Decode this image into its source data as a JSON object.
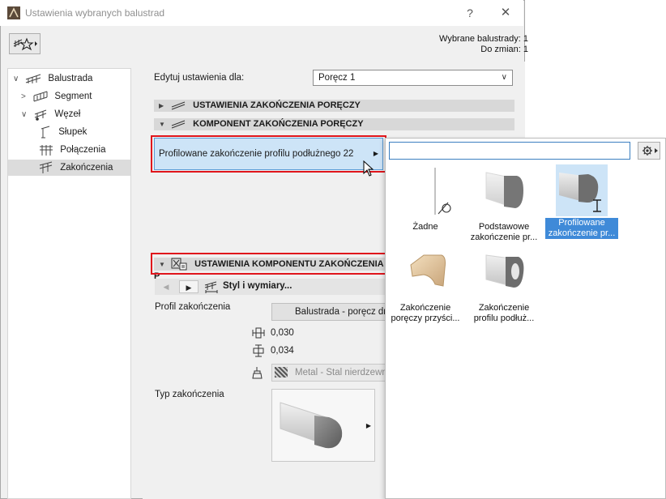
{
  "window": {
    "title": "Ustawienia wybranych balustrad",
    "help": "?",
    "close": "✕"
  },
  "info": {
    "selected": "Wybrane balustrady: 1",
    "to_change": "Do zmian: 1"
  },
  "tree": {
    "items": [
      {
        "label": "Balustrada",
        "arrow": "∨"
      },
      {
        "label": "Segment",
        "arrow": ">"
      },
      {
        "label": "Węzeł",
        "arrow": "∨"
      },
      {
        "label": "Słupek",
        "arrow": ""
      },
      {
        "label": "Połączenia",
        "arrow": ""
      },
      {
        "label": "Zakończenia",
        "arrow": ""
      }
    ],
    "selected_index": 5
  },
  "edit": {
    "label": "Edytuj ustawienia dla:",
    "value": "Poręcz 1"
  },
  "sections": {
    "end_settings": "USTAWIENIA ZAKOŃCZENIA PORĘCZY",
    "end_component": "KOMPONENT ZAKOŃCZENIA PORĘCZY",
    "component_settings": "USTAWIENIA KOMPONENTU ZAKOŃCZENIA P"
  },
  "component_button": "Profilowane zakończenie profilu podłużnego 22",
  "nav": {
    "style_label": "Styl i wymiary..."
  },
  "profile": {
    "label": "Profil zakończenia",
    "value": "Balustrada - poręcz dr",
    "dim1": "0,030",
    "dim2": "0,034",
    "material": "Metal - Stal nierdzewn"
  },
  "type": {
    "label": "Typ zakończenia"
  },
  "popup": {
    "search_value": "",
    "tiles": [
      {
        "line1": "Żadne",
        "line2": ""
      },
      {
        "line1": "Podstawowe",
        "line2": "zakończenie pr..."
      },
      {
        "line1": "Profilowane",
        "line2": "zakończenie pr..."
      },
      {
        "line1": "Zakończenie",
        "line2": "poręczy przyści..."
      },
      {
        "line1": "Zakończenie",
        "line2": "profilu podłuż..."
      }
    ],
    "selected_index": 2
  },
  "colors": {
    "highlight_border": "#e0151c",
    "selection_blue": "#3f8ad8"
  }
}
